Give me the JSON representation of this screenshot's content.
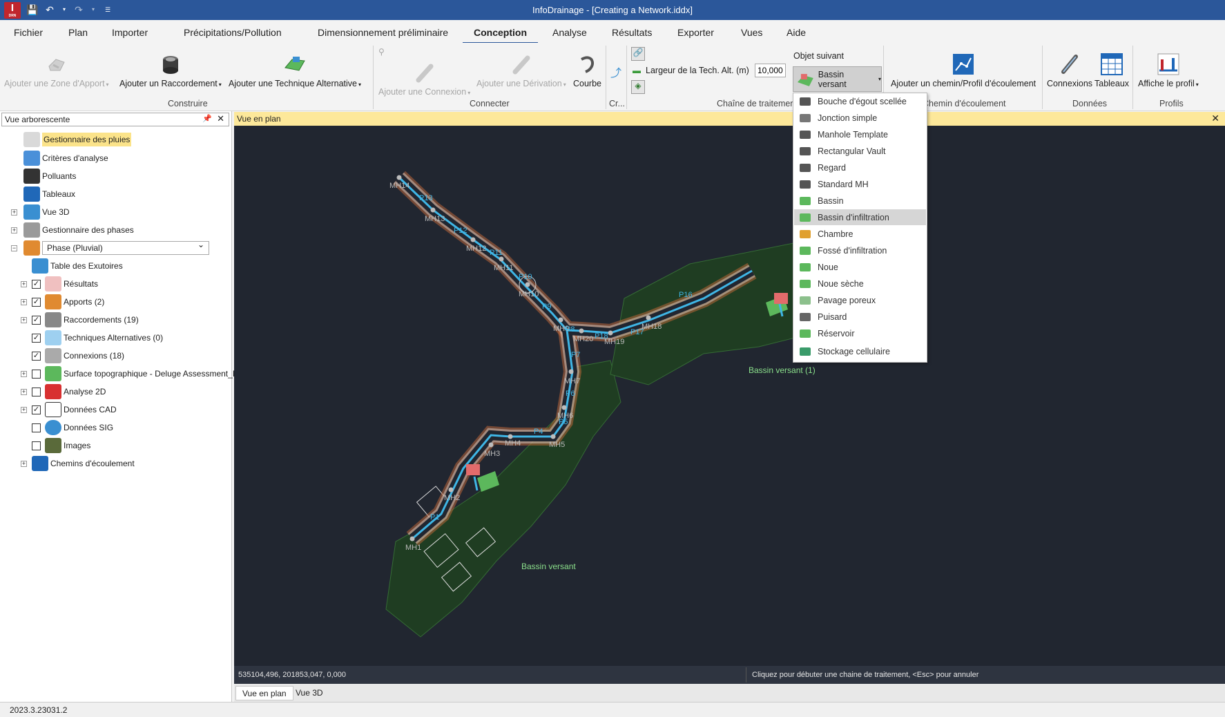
{
  "app": {
    "title": "InfoDrainage - [Creating a Network.iddx]",
    "logo_letter": "I",
    "logo_sub": "DRN"
  },
  "menu": [
    "Fichier",
    "Plan",
    "Importer",
    "Précipitations/Pollution",
    "Dimensionnement préliminaire",
    "Conception",
    "Analyse",
    "Résultats",
    "Exporter",
    "Vues",
    "Aide"
  ],
  "ribbon": {
    "construire": {
      "label": "Construire",
      "zone_apport": "Ajouter une Zone d'Apport",
      "raccordement": "Ajouter un Raccordement",
      "technique": "Ajouter une Technique Alternative"
    },
    "connecter": {
      "label": "Connecter",
      "connexion": "Ajouter une Connexion",
      "derivation": "Ajouter une Dérivation",
      "courbe": "Courbe"
    },
    "cr_label": "Cr...",
    "chaine": {
      "label": "Chaîne de traitement",
      "largeur_label": "Largeur de la Tech. Alt. (m)",
      "largeur_value": "10,000",
      "objet_suivant": "Objet suivant",
      "objet_value": "Bassin versant"
    },
    "chemin": {
      "label": "Chemin d'écoulement",
      "btn": "Ajouter un chemin/Profil d'écoulement"
    },
    "donnees": {
      "label": "Données",
      "connexions": "Connexions",
      "tableaux": "Tableaux"
    },
    "profils": {
      "label": "Profils",
      "affiche": "Affiche le profil"
    }
  },
  "tree": {
    "header": "Vue arborescente",
    "items": [
      "Gestionnaire des pluies",
      "Critères d'analyse",
      "Polluants",
      "Tableaux",
      "Vue 3D",
      "Gestionnaire des phases",
      "Phase (Pluvial)",
      "Table des Exutoires",
      "Résultats",
      "Apports (2)",
      "Raccordements (19)",
      "Techniques Alternatives (0)",
      "Connexions (18)",
      "Surface topographique - Deluge Assessment_Phas",
      "Analyse 2D",
      "Données CAD",
      "Données SIG",
      "Images",
      "Chemins d'écoulement"
    ]
  },
  "view": {
    "header": "Vue en plan",
    "coords": "535104,496, 201853,047, 0,000",
    "hint": "Cliquez pour débuter une chaine de traitement, <Esc> pour annuler",
    "tabs": [
      "Vue en plan",
      "Vue 3D"
    ]
  },
  "network": {
    "nodes": [
      "MH1",
      "MH2",
      "MH3",
      "MH4",
      "MH5",
      "MH6",
      "MH7",
      "MH9",
      "MH10",
      "MH11",
      "MH12",
      "MH13",
      "MH14",
      "MH18",
      "MH19",
      "MH20"
    ],
    "pipes": [
      "P1",
      "P4",
      "P5",
      "P6",
      "P7",
      "P8",
      "P9",
      "P10",
      "P11",
      "P12",
      "P13",
      "P16",
      "P17",
      "P18"
    ],
    "catchments": [
      "Bassin versant",
      "Bassin versant (1)"
    ]
  },
  "dropdown": {
    "items": [
      "Bouche d'égout scellée",
      "Jonction simple",
      "Manhole Template",
      "Rectangular Vault",
      "Regard",
      "Standard MH",
      "Bassin",
      "Bassin d'infiltration",
      "Chambre",
      "Fossé d'infiltration",
      "Noue",
      "Noue sèche",
      "Pavage poreux",
      "Puisard",
      "Réservoir",
      "Stockage cellulaire"
    ],
    "highlighted": "Bassin d'infiltration"
  },
  "version": "2023.3.23031.2",
  "colors": {
    "accent": "#2b579a",
    "canvas": "#212630",
    "pipe": "#3fb6e6",
    "catchment": "#1f3d22"
  }
}
